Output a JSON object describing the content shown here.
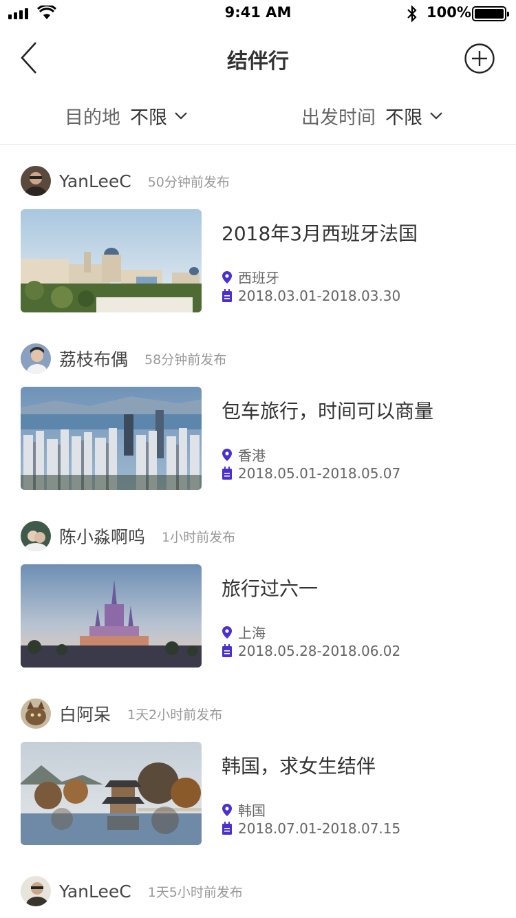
{
  "status_bar": {
    "time": "9:41 AM",
    "battery": "100%"
  },
  "nav": {
    "title": "结伴行"
  },
  "filters": {
    "destination": {
      "label": "目的地",
      "value": "不限"
    },
    "depart_time": {
      "label": "出发时间",
      "value": "不限"
    }
  },
  "accent_color": "#4b2fd0",
  "posts": [
    {
      "author": "YanLeeC",
      "posted": "50分钟前发布",
      "title": "2018年3月西班牙法国",
      "location": "西班牙",
      "dates": "2018.03.01-2018.03.30"
    },
    {
      "author": "荔枝布偶",
      "posted": "58分钟前发布",
      "title": "包车旅行，时间可以商量",
      "location": "香港",
      "dates": "2018.05.01-2018.05.07"
    },
    {
      "author": "陈小淼啊呜",
      "posted": "1小时前发布",
      "title": "旅行过六一",
      "location": "上海",
      "dates": "2018.05.28-2018.06.02"
    },
    {
      "author": "白阿呆",
      "posted": "1天2小时前发布",
      "title": "韩国，求女生结伴",
      "location": "韩国",
      "dates": "2018.07.01-2018.07.15"
    },
    {
      "author": "YanLeeC",
      "posted": "1天5小时前发布"
    }
  ]
}
